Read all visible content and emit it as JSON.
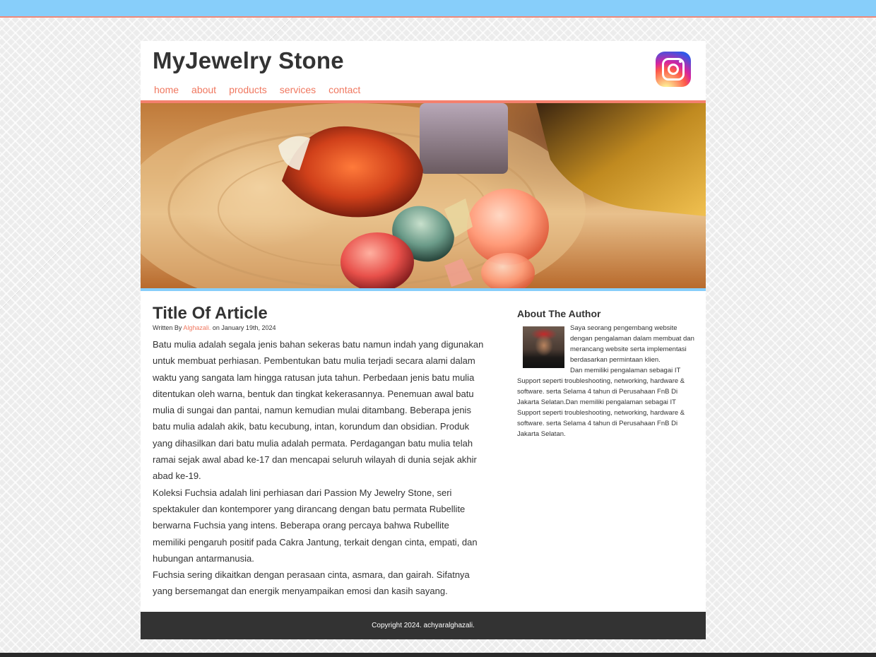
{
  "site": {
    "title": "MyJewelry Stone",
    "nav": [
      "home",
      "about",
      "products",
      "services",
      "contact"
    ]
  },
  "social": {
    "icon": "instagram-icon"
  },
  "colors": {
    "accent": "#f4806e",
    "link": "#f07860",
    "topbar": "#87cefa",
    "footer_bg": "#333333"
  },
  "article": {
    "title": "Title Of Article",
    "byline_prefix": "Written By",
    "author": "Alghazali.",
    "byline_suffix": "on January 19th, 2024",
    "paragraphs": [
      "Batu mulia adalah segala jenis bahan sekeras batu namun indah yang digunakan untuk membuat perhiasan. Pembentukan batu mulia terjadi secara alami dalam waktu yang sangata lam hingga ratusan juta tahun. Perbedaan jenis batu mulia ditentukan oleh warna, bentuk dan tingkat kekerasannya. Penemuan awal batu mulia di sungai dan pantai, namun kemudian mulai ditambang. Beberapa jenis batu mulia adalah akik, batu kecubung, intan, korundum dan obsidian. Produk yang dihasilkan dari batu mulia adalah permata. Perdagangan batu mulia telah ramai sejak awal abad ke-17 dan mencapai seluruh wilayah di dunia sejak akhir abad ke-19.",
      "Koleksi Fuchsia adalah lini perhiasan dari Passion My Jewelry Stone, seri spektakuler dan kontemporer yang dirancang dengan batu permata Rubellite berwarna Fuchsia yang intens. Beberapa orang percaya bahwa Rubellite memiliki pengaruh positif pada Cakra Jantung, terkait dengan cinta, empati, dan hubungan antarmanusia.",
      "Fuchsia sering dikaitkan dengan perasaan cinta, asmara, dan gairah. Sifatnya yang bersemangat dan energik menyampaikan emosi dan kasih sayang."
    ]
  },
  "sidebar": {
    "title": "About The Author",
    "bio": "Saya seorang pengembang website dengan pengalaman dalam membuat dan merancang website serta implementasi berdasarkan permintaan klien.",
    "bio_more": "Dan memiliki pengalaman sebagai IT Support seperti troubleshooting, networking, hardware & software. serta Selama 4 tahun di Perusahaan FnB Di Jakarta Selatan.Dan memiliki pengalaman sebagai IT Support seperti troubleshooting, networking, hardware & software. serta Selama 4 tahun di Perusahaan FnB Di Jakarta Selatan."
  },
  "footer": {
    "copyright": "Copyright 2024. achyaralghazali."
  }
}
